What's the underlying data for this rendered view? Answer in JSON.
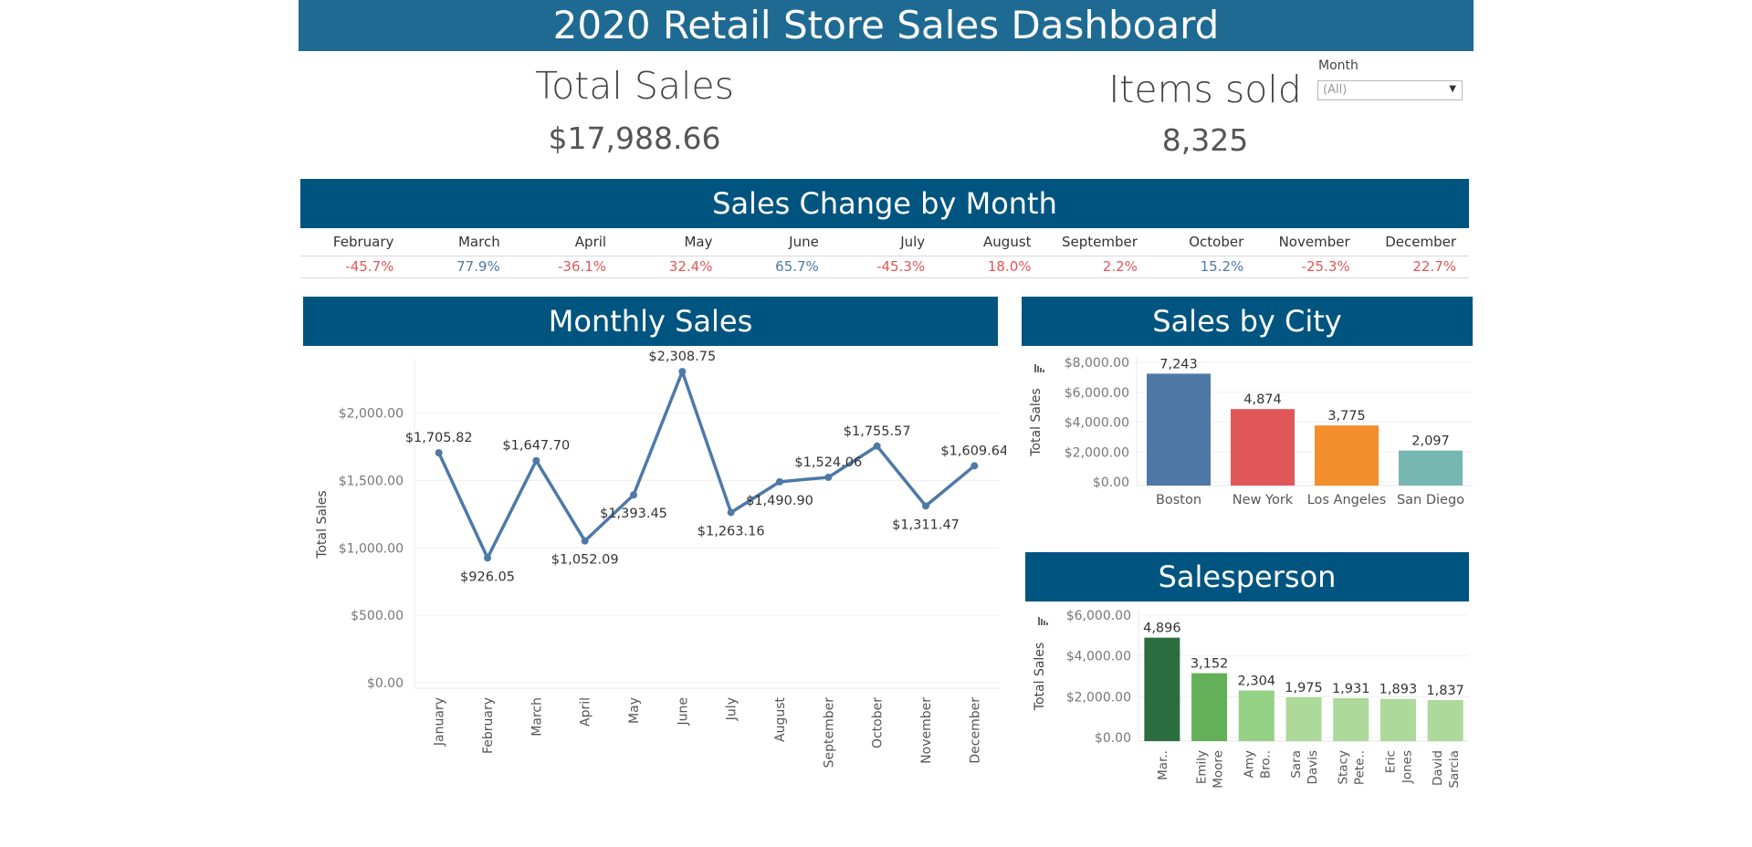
{
  "header": {
    "title": "2020 Retail Store Sales Dashboard"
  },
  "kpis": {
    "total_sales_label": "Total Sales",
    "total_sales_value": "$17,988.66",
    "items_sold_label": "Items sold",
    "items_sold_value": "8,325"
  },
  "filter": {
    "label": "Month",
    "value": "(All)"
  },
  "sales_change": {
    "title": "Sales Change by Month",
    "months": [
      "February",
      "March",
      "April",
      "May",
      "June",
      "July",
      "August",
      "September",
      "October",
      "November",
      "December"
    ],
    "values": [
      "-45.7%",
      "77.9%",
      "-36.1%",
      "32.4%",
      "65.7%",
      "-45.3%",
      "18.0%",
      "2.2%",
      "15.2%",
      "-25.3%",
      "22.7%"
    ],
    "colors": [
      "#e15759",
      "#4e79a7",
      "#e15759",
      "#e15759",
      "#4e79a7",
      "#e15759",
      "#e15759",
      "#e15759",
      "#4e79a7",
      "#e15759",
      "#e15759"
    ]
  },
  "monthly_sales_title": "Monthly Sales",
  "sales_by_city_title": "Sales by City",
  "salesperson_title": "Salesperson",
  "colors": {
    "banner": "#005580",
    "line": "#4e79a7"
  },
  "chart_data": [
    {
      "type": "line",
      "title": "Monthly Sales",
      "xlabel": "",
      "ylabel": "Total Sales",
      "categories": [
        "January",
        "February",
        "March",
        "April",
        "May",
        "June",
        "July",
        "August",
        "September",
        "October",
        "November",
        "December"
      ],
      "values": [
        1705.82,
        926.05,
        1647.7,
        1052.09,
        1393.45,
        2308.75,
        1263.16,
        1490.9,
        1524.06,
        1755.57,
        1311.47,
        1609.64
      ],
      "data_labels": [
        "$1,705.82",
        "$926.05",
        "$1,647.70",
        "$1,052.09",
        "$1,393.45",
        "$2,308.75",
        "$1,263.16",
        "$1,490.90",
        "$1,524.06",
        "$1,755.57",
        "$1,311.47",
        "$1,609.64"
      ],
      "label_position": [
        "above",
        "below",
        "above",
        "below",
        "below",
        "above",
        "below",
        "below",
        "above",
        "above",
        "below",
        "above"
      ],
      "yticks": [
        "$0.00",
        "$500.00",
        "$1,000.00",
        "$1,500.00",
        "$2,000.00"
      ],
      "ytick_values": [
        0,
        500,
        1000,
        1500,
        2000
      ],
      "ylim": [
        0,
        2350
      ],
      "color": "#4e79a7"
    },
    {
      "type": "bar",
      "title": "Sales by City",
      "ylabel": "Total Sales",
      "categories": [
        "Boston",
        "New York",
        "Los Angeles",
        "San Diego"
      ],
      "values": [
        7243,
        4874,
        3775,
        2097
      ],
      "data_labels": [
        "7,243",
        "4,874",
        "3,775",
        "2,097"
      ],
      "colors": [
        "#4e79a7",
        "#e15759",
        "#f28e2b",
        "#76b7b2"
      ],
      "yticks": [
        "$0.00",
        "$2,000.00",
        "$4,000.00",
        "$6,000.00",
        "$8,000.00"
      ],
      "ytick_values": [
        0,
        2000,
        4000,
        6000,
        8000
      ],
      "ylim": [
        0,
        8000
      ]
    },
    {
      "type": "bar",
      "title": "Salesperson",
      "ylabel": "Total Sales",
      "categories": [
        [
          "Mar.."
        ],
        [
          "Emily",
          "Moore"
        ],
        [
          "Amy",
          "Bro.."
        ],
        [
          "Sara",
          "Davis"
        ],
        [
          "Stacy",
          "Pete.."
        ],
        [
          "Eric",
          "Jones"
        ],
        [
          "David",
          "Sarcia"
        ]
      ],
      "values": [
        4896,
        3152,
        2304,
        1975,
        1931,
        1893,
        1837
      ],
      "data_labels": [
        "4,896",
        "3,152",
        "2,304",
        "1,975",
        "1,931",
        "1,893",
        "1,837"
      ],
      "colors": [
        "#2a6e3f",
        "#62b058",
        "#95d184",
        "#add99a",
        "#add99a",
        "#add99a",
        "#add99a"
      ],
      "yticks": [
        "$0.00",
        "$2,000.00",
        "$4,000.00",
        "$6,000.00"
      ],
      "ytick_values": [
        0,
        2000,
        4000,
        6000
      ],
      "ylim": [
        0,
        6000
      ]
    }
  ]
}
